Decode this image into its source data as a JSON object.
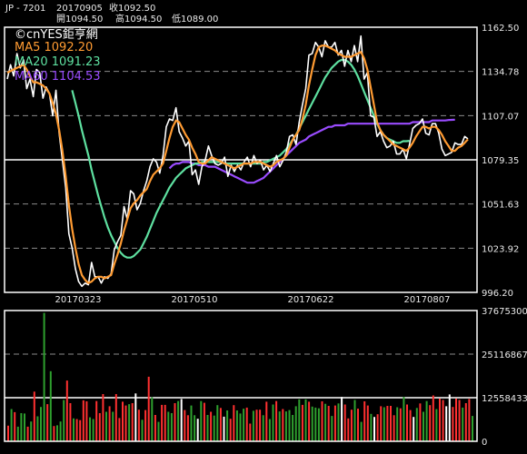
{
  "header": {
    "symbol": "JP - 7201",
    "date": "20170905",
    "close_label": "收1092.50",
    "open_label": "開1094.50",
    "high_label": "高1094.50",
    "low_label": "低1089.00"
  },
  "watermark": "©cnYES鉅亨網",
  "chart_data": [
    {
      "type": "line",
      "series": [
        {
          "name": "close",
          "color": "#ffffff"
        },
        {
          "name": "MA5 1092.20",
          "color": "#ff9b32"
        },
        {
          "name": "MA20 1091.23",
          "color": "#5ee0a0"
        },
        {
          "name": "MA60 1104.53",
          "color": "#9a4cff"
        }
      ],
      "x_tick_labels": [
        "20170323",
        "20170510",
        "20170622",
        "20170807"
      ],
      "y_tick_labels": [
        "1162.50",
        "1134.78",
        "1107.07",
        "1079.35",
        "1051.63",
        "1023.92",
        "996.20"
      ],
      "ylim": [
        996.2,
        1162.5
      ],
      "reference_line": 1079.35,
      "close": [
        1130,
        1139,
        1132,
        1146,
        1137,
        1142,
        1124,
        1130,
        1119,
        1136,
        1134,
        1118,
        1125,
        1121,
        1107,
        1123,
        1096,
        1079,
        1062,
        1033,
        1024,
        1011,
        1003,
        1000,
        1002,
        1001,
        1015,
        1006,
        1006,
        1002,
        1006,
        1005,
        1008,
        1023,
        1028,
        1032,
        1050,
        1042,
        1060,
        1058,
        1048,
        1052,
        1060,
        1066,
        1075,
        1080,
        1078,
        1071,
        1082,
        1100,
        1105,
        1104,
        1112,
        1097,
        1093,
        1088,
        1091,
        1070,
        1073,
        1064,
        1075,
        1079,
        1088,
        1082,
        1077,
        1076,
        1077,
        1081,
        1069,
        1076,
        1072,
        1076,
        1073,
        1078,
        1081,
        1075,
        1082,
        1077,
        1079,
        1073,
        1076,
        1072,
        1077,
        1082,
        1075,
        1079,
        1084,
        1094,
        1095,
        1089,
        1103,
        1114,
        1124,
        1145,
        1146,
        1153,
        1150,
        1144,
        1154,
        1150,
        1150,
        1153,
        1145,
        1148,
        1138,
        1148,
        1141,
        1151,
        1141,
        1157,
        1130,
        1134,
        1107,
        1106,
        1094,
        1097,
        1091,
        1087,
        1088,
        1091,
        1083,
        1083,
        1086,
        1080,
        1089,
        1099,
        1101,
        1102,
        1105,
        1096,
        1095,
        1102,
        1102,
        1096,
        1086,
        1082,
        1083,
        1084,
        1090,
        1089,
        1089,
        1094,
        1092.5
      ],
      "ma5": [
        1134,
        1135,
        1136,
        1137,
        1138,
        1139,
        1136,
        1132,
        1128,
        1128,
        1127,
        1126,
        1124,
        1121,
        1115,
        1108,
        1098,
        1085,
        1069,
        1051,
        1036,
        1024,
        1014,
        1007,
        1004,
        1002,
        1003,
        1005,
        1006,
        1006,
        1005,
        1006,
        1007,
        1014,
        1020,
        1027,
        1035,
        1042,
        1049,
        1052,
        1054,
        1057,
        1059,
        1061,
        1066,
        1070,
        1072,
        1074,
        1077,
        1085,
        1093,
        1100,
        1104,
        1103,
        1099,
        1095,
        1092,
        1087,
        1083,
        1078,
        1077,
        1077,
        1079,
        1081,
        1080,
        1079,
        1078,
        1077,
        1076,
        1075,
        1074,
        1075,
        1076,
        1077,
        1077,
        1077,
        1078,
        1078,
        1078,
        1077,
        1076,
        1075,
        1076,
        1078,
        1079,
        1080,
        1082,
        1087,
        1092,
        1095,
        1098,
        1105,
        1114,
        1126,
        1136,
        1145,
        1150,
        1151,
        1151,
        1150,
        1149,
        1148,
        1146,
        1145,
        1144,
        1144,
        1144,
        1145,
        1146,
        1147,
        1143,
        1136,
        1125,
        1114,
        1103,
        1098,
        1095,
        1093,
        1091,
        1089,
        1088,
        1087,
        1086,
        1085,
        1087,
        1090,
        1094,
        1097,
        1100,
        1100,
        1099,
        1100,
        1100,
        1098,
        1095,
        1091,
        1088,
        1085,
        1085,
        1087,
        1088,
        1090,
        1092.2
      ],
      "ma20": [
        null,
        null,
        null,
        null,
        null,
        null,
        null,
        null,
        null,
        null,
        null,
        null,
        null,
        null,
        null,
        null,
        null,
        null,
        null,
        null,
        1123,
        1115,
        1107,
        1098,
        1090,
        1082,
        1073,
        1065,
        1057,
        1050,
        1043,
        1037,
        1032,
        1028,
        1024,
        1021,
        1019,
        1018,
        1018,
        1019,
        1021,
        1023,
        1027,
        1031,
        1036,
        1041,
        1046,
        1050,
        1054,
        1058,
        1062,
        1065,
        1068,
        1070,
        1072,
        1074,
        1075,
        1076,
        1077,
        1077,
        1078,
        1078,
        1078,
        1078,
        1078,
        1078,
        1078,
        1077,
        1077,
        1077,
        1077,
        1077,
        1077,
        1077,
        1077,
        1077,
        1077,
        1077,
        1077,
        1078,
        1078,
        1079,
        1080,
        1081,
        1082,
        1084,
        1086,
        1089,
        1092,
        1095,
        1099,
        1103,
        1107,
        1111,
        1115,
        1119,
        1123,
        1127,
        1131,
        1134,
        1137,
        1139,
        1141,
        1142,
        1142,
        1141,
        1139,
        1136,
        1132,
        1127,
        1122,
        1117,
        1112,
        1107,
        1102,
        1098,
        1095,
        1093,
        1092,
        1091,
        1090,
        1090,
        1091,
        1091,
        1091.23
      ],
      "ma60": [
        null,
        null,
        null,
        null,
        null,
        null,
        null,
        null,
        null,
        null,
        null,
        null,
        null,
        null,
        null,
        null,
        null,
        null,
        null,
        null,
        null,
        null,
        null,
        null,
        null,
        null,
        null,
        null,
        null,
        null,
        null,
        null,
        null,
        null,
        null,
        null,
        null,
        null,
        null,
        null,
        null,
        null,
        null,
        null,
        null,
        null,
        null,
        null,
        null,
        null,
        1074,
        1076,
        1077,
        1077,
        1078,
        1078,
        1078,
        1077,
        1077,
        1076,
        1076,
        1076,
        1075,
        1075,
        1075,
        1074,
        1073,
        1072,
        1071,
        1070,
        1069,
        1068,
        1067,
        1066,
        1065,
        1065,
        1065,
        1066,
        1067,
        1068,
        1070,
        1072,
        1074,
        1076,
        1078,
        1080,
        1082,
        1084,
        1086,
        1088,
        1090,
        1091,
        1092,
        1094,
        1095,
        1096,
        1097,
        1098,
        1099,
        1100,
        1100,
        1101,
        1101,
        1101,
        1101,
        1102,
        1102,
        1102,
        1102,
        1102,
        1102,
        1102,
        1102,
        1102,
        1102,
        1102,
        1102,
        1102,
        1102,
        1102,
        1102,
        1102,
        1102,
        1102,
        1102,
        1103,
        1103,
        1103,
        1103,
        1103,
        1103,
        1104,
        1104,
        1104,
        1104,
        1104,
        1104.3,
        1104.4,
        1104.53
      ]
    },
    {
      "type": "bar",
      "y_tick_labels": [
        "37675300",
        "25116867",
        "12558433",
        "0"
      ],
      "ylim": [
        0,
        37675300
      ],
      "reference_line": 12558433,
      "up_color": "#ff3030",
      "down_color": "#2ea02e",
      "flat_color": "#ffffff",
      "volume_millions": [
        4.5,
        9.3,
        8.4,
        4.2,
        8.1,
        8.0,
        4.2,
        5.7,
        14.3,
        7.2,
        9.9,
        37.0,
        10.7,
        20.2,
        4.4,
        4.6,
        5.7,
        11.9,
        17.5,
        11.0,
        6.6,
        6.4,
        6.1,
        11.8,
        11.5,
        6.9,
        6.4,
        11.6,
        8.1,
        13.6,
        8.5,
        10.1,
        8.5,
        13.6,
        6.7,
        11.4,
        10.3,
        10.7,
        11.0,
        13.8,
        9.1,
        6.2,
        9.0,
        18.6,
        12.7,
        7.6,
        5.6,
        10.5,
        10.5,
        8.5,
        8.1,
        11.0,
        11.6,
        12.2,
        9.0,
        7.5,
        10.3,
        7.5,
        6.5,
        11.6,
        11.1,
        7.6,
        8.5,
        7.4,
        10.4,
        9.6,
        7.1,
        8.9,
        6.5,
        10.4,
        8.9,
        8.0,
        9.4,
        9.7,
        5.1,
        8.8,
        9.1,
        9.1,
        7.5,
        11.4,
        6.4,
        10.6,
        11.6,
        8.6,
        9.3,
        8.6,
        9.0,
        7.6,
        10.1,
        12.1,
        10.5,
        12.1,
        11.4,
        10.0,
        9.7,
        9.5,
        11.5,
        10.8,
        10.2,
        7.3,
        10.3,
        10.9,
        12.8,
        10.6,
        6.6,
        9.1,
        11.9,
        9.4,
        5.6,
        11.5,
        10.3,
        7.9,
        7.0,
        7.8,
        10.1,
        9.8,
        10.2,
        10.2,
        7.5,
        9.8,
        9.5,
        12.8,
        10.6,
        9.0,
        7.0,
        9.6,
        10.9,
        8.5,
        11.6,
        10.4,
        13.2,
        9.3,
        12.3,
        11.9,
        10.1,
        13.5,
        9.9,
        12.3,
        11.9,
        9.7,
        11.0,
        12.2,
        7.3
      ],
      "volume_direction": [
        "u",
        "d",
        "u",
        "d",
        "d",
        "d",
        "u",
        "d",
        "u",
        "d",
        "d",
        "d",
        "u",
        "d",
        "u",
        "d",
        "d",
        "d",
        "u",
        "u",
        "d",
        "u",
        "u",
        "u",
        "u",
        "d",
        "d",
        "u",
        "u",
        "u",
        "d",
        "u",
        "d",
        "u",
        "u",
        "u",
        "u",
        "d",
        "u",
        "f",
        "u",
        "d",
        "u",
        "u",
        "d",
        "u",
        "d",
        "u",
        "u",
        "d",
        "d",
        "u",
        "d",
        "f",
        "u",
        "u",
        "d",
        "d",
        "f",
        "d",
        "u",
        "d",
        "u",
        "d",
        "d",
        "u",
        "f",
        "d",
        "u",
        "u",
        "d",
        "d",
        "d",
        "u",
        "u",
        "d",
        "u",
        "u",
        "d",
        "u",
        "d",
        "d",
        "u",
        "d",
        "u",
        "d",
        "d",
        "d",
        "d",
        "d",
        "u",
        "d",
        "u",
        "d",
        "d",
        "d",
        "u",
        "d",
        "u",
        "d",
        "u",
        "d",
        "f",
        "u",
        "u",
        "u",
        "d",
        "u",
        "d",
        "u",
        "u",
        "d",
        "f",
        "u",
        "u",
        "d",
        "u",
        "u",
        "u",
        "d",
        "u",
        "d",
        "u",
        "u",
        "f",
        "d",
        "u",
        "d",
        "d",
        "u",
        "u",
        "d",
        "u",
        "u",
        "f",
        "f",
        "u",
        "u",
        "u",
        "d",
        "u",
        "u",
        "d"
      ]
    }
  ]
}
